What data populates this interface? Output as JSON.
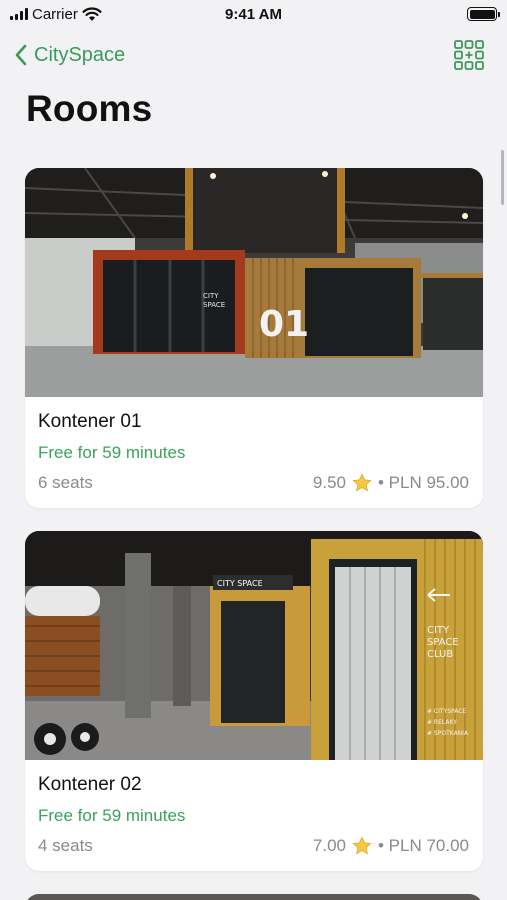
{
  "status_bar": {
    "carrier": "Carrier",
    "time": "9:41 AM"
  },
  "nav": {
    "back_label": "CitySpace",
    "accent_color": "#3a9a5a"
  },
  "title": "Rooms",
  "rooms": [
    {
      "name": "Kontener 01",
      "availability": "Free for 59 minutes",
      "seats": "6 seats",
      "rating": "9.50",
      "price": "• PLN 95.00",
      "photo_signage": [
        "CITY",
        "SPACE",
        "01"
      ]
    },
    {
      "name": "Kontener 02",
      "availability": "Free for 59 minutes",
      "seats": "4 seats",
      "rating": "7.00",
      "price": "• PLN 70.00",
      "photo_signage": [
        "CITY SPACE",
        "CITY",
        "SPACE",
        "CLUB",
        "# CITYSPACE",
        "# RELAKY",
        "# SPOTKANIA"
      ]
    }
  ]
}
